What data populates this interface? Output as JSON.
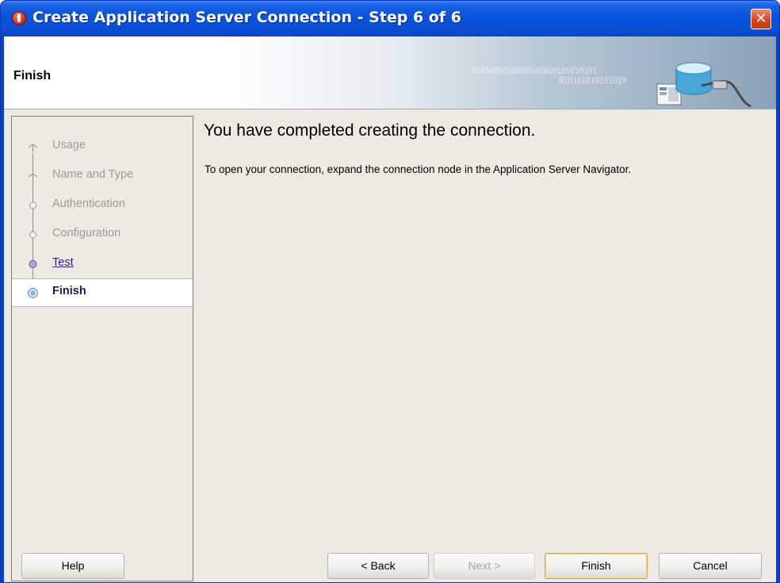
{
  "window": {
    "title": "Create Application Server Connection - Step 6 of 6",
    "close_glyph": "✕"
  },
  "header": {
    "title": "Finish",
    "binary_decoration_1": "0101010101010101010101010101",
    "binary_decoration_2": "010101010101010"
  },
  "steps": [
    {
      "label": "Usage",
      "state": "done"
    },
    {
      "label": "Name and Type",
      "state": "done"
    },
    {
      "label": "Authentication",
      "state": "done"
    },
    {
      "label": "Configuration",
      "state": "done"
    },
    {
      "label": "Test",
      "state": "link"
    },
    {
      "label": "Finish",
      "state": "current"
    }
  ],
  "content": {
    "heading": "You have completed creating the connection.",
    "message": "To open your connection, expand the connection node in the Application Server Navigator."
  },
  "buttons": {
    "help": "Help",
    "back": "< Back",
    "next": "Next >",
    "finish": "Finish",
    "cancel": "Cancel"
  },
  "colors": {
    "titlebar": "#0853dc",
    "client_bg": "#eceae3",
    "current_step_bg": "#ffffff",
    "default_button_border": "#e0a948"
  },
  "icons": {
    "app": "oracle-app-icon",
    "close": "close-icon",
    "header": "database-server-connection-icon"
  }
}
